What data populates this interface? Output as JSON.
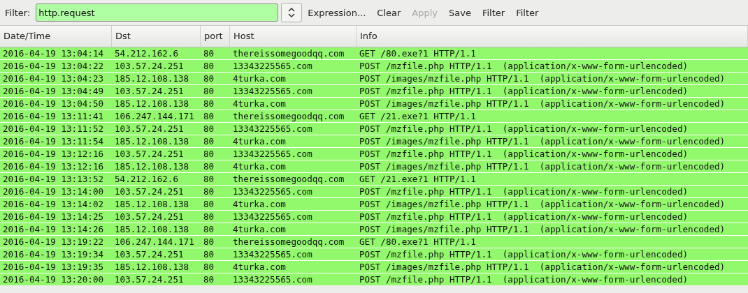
{
  "filter_bar": {
    "label": "Filter:",
    "value": "http.request",
    "buttons": [
      {
        "label": "Expression...",
        "disabled": false
      },
      {
        "label": "Clear",
        "disabled": false
      },
      {
        "label": "Apply",
        "disabled": true
      },
      {
        "label": "Save",
        "disabled": false
      },
      {
        "label": "Filter",
        "disabled": false
      },
      {
        "label": "Filter",
        "disabled": false
      }
    ]
  },
  "table": {
    "columns": [
      "Date/Time",
      "Dst",
      "port",
      "Host",
      "Info"
    ],
    "rows": [
      [
        "2016-04-19 13:04:14",
        "54.212.162.6",
        "80",
        "thereissomegoodqq.com",
        "GET /80.exe?1 HTTP/1.1"
      ],
      [
        "2016-04-19 13:04:22",
        "103.57.24.251",
        "80",
        "13343225565.com",
        "POST /mzfile.php HTTP/1.1  (application/x-www-form-urlencoded)"
      ],
      [
        "2016-04-19 13:04:23",
        "185.12.108.138",
        "80",
        "4turka.com",
        "POST /images/mzfile.php HTTP/1.1  (application/x-www-form-urlencoded)"
      ],
      [
        "2016-04-19 13:04:49",
        "103.57.24.251",
        "80",
        "13343225565.com",
        "POST /mzfile.php HTTP/1.1  (application/x-www-form-urlencoded)"
      ],
      [
        "2016-04-19 13:04:50",
        "185.12.108.138",
        "80",
        "4turka.com",
        "POST /images/mzfile.php HTTP/1.1  (application/x-www-form-urlencoded)"
      ],
      [
        "2016-04-19 13:11:41",
        "106.247.144.171",
        "80",
        "thereissomegoodqq.com",
        "GET /21.exe?1 HTTP/1.1"
      ],
      [
        "2016-04-19 13:11:52",
        "103.57.24.251",
        "80",
        "13343225565.com",
        "POST /mzfile.php HTTP/1.1  (application/x-www-form-urlencoded)"
      ],
      [
        "2016-04-19 13:11:54",
        "185.12.108.138",
        "80",
        "4turka.com",
        "POST /images/mzfile.php HTTP/1.1  (application/x-www-form-urlencoded)"
      ],
      [
        "2016-04-19 13:12:16",
        "103.57.24.251",
        "80",
        "13343225565.com",
        "POST /mzfile.php HTTP/1.1  (application/x-www-form-urlencoded)"
      ],
      [
        "2016-04-19 13:12:16",
        "185.12.108.138",
        "80",
        "4turka.com",
        "POST /images/mzfile.php HTTP/1.1  (application/x-www-form-urlencoded)"
      ],
      [
        "2016-04-19 13:13:52",
        "54.212.162.6",
        "80",
        "thereissomegoodqq.com",
        "GET /21.exe?1 HTTP/1.1"
      ],
      [
        "2016-04-19 13:14:00",
        "103.57.24.251",
        "80",
        "13343225565.com",
        "POST /mzfile.php HTTP/1.1  (application/x-www-form-urlencoded)"
      ],
      [
        "2016-04-19 13:14:02",
        "185.12.108.138",
        "80",
        "4turka.com",
        "POST /images/mzfile.php HTTP/1.1  (application/x-www-form-urlencoded)"
      ],
      [
        "2016-04-19 13:14:25",
        "103.57.24.251",
        "80",
        "13343225565.com",
        "POST /mzfile.php HTTP/1.1  (application/x-www-form-urlencoded)"
      ],
      [
        "2016-04-19 13:14:26",
        "185.12.108.138",
        "80",
        "4turka.com",
        "POST /images/mzfile.php HTTP/1.1  (application/x-www-form-urlencoded)"
      ],
      [
        "2016-04-19 13:19:22",
        "106.247.144.171",
        "80",
        "thereissomegoodqq.com",
        "GET /80.exe?1 HTTP/1.1"
      ],
      [
        "2016-04-19 13:19:34",
        "103.57.24.251",
        "80",
        "13343225565.com",
        "POST /mzfile.php HTTP/1.1  (application/x-www-form-urlencoded)"
      ],
      [
        "2016-04-19 13:19:35",
        "185.12.108.138",
        "80",
        "4turka.com",
        "POST /images/mzfile.php HTTP/1.1  (application/x-www-form-urlencoded)"
      ],
      [
        "2016-04-19 13:20:00",
        "103.57.24.251",
        "80",
        "13343225565.com",
        "POST /mzfile.php HTTP/1.1  (application/x-www-form-urlencoded)"
      ]
    ]
  }
}
